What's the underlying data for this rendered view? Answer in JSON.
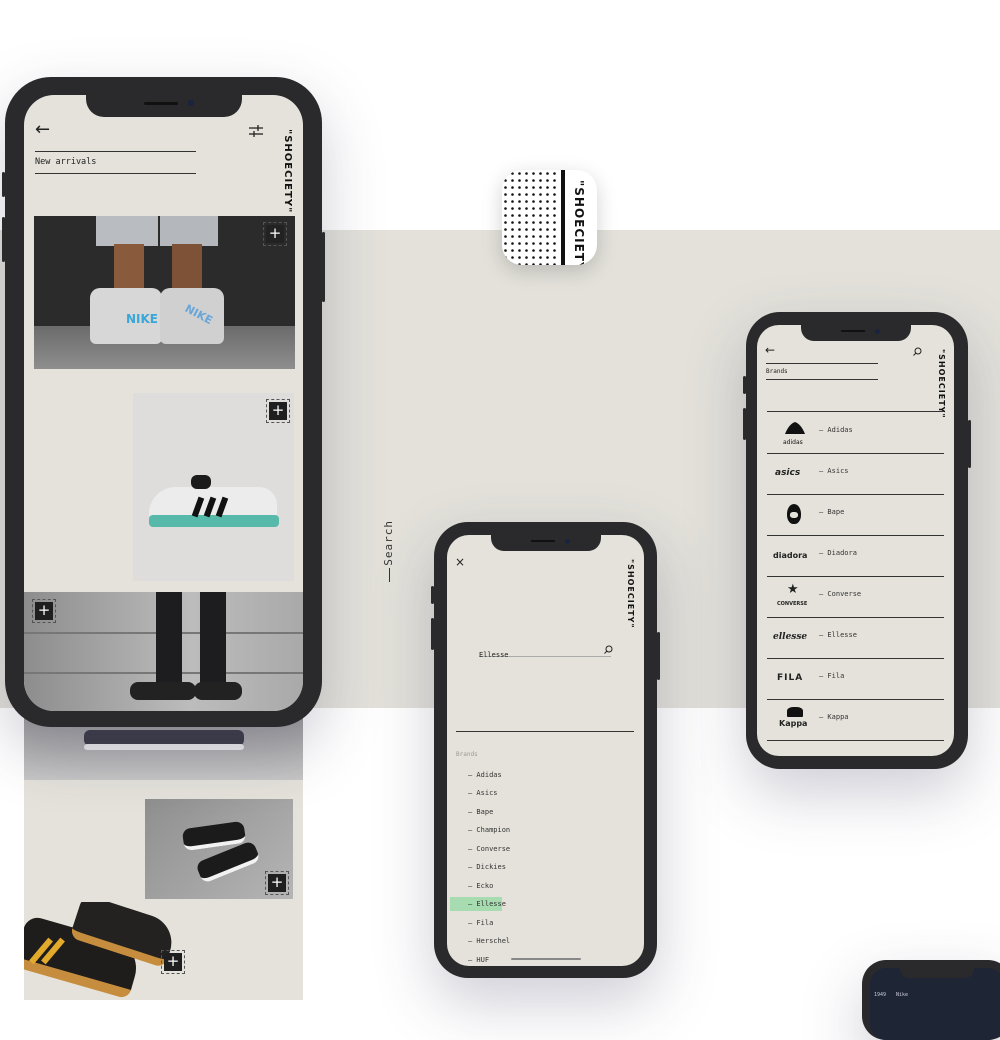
{
  "brand_name": "\"SHOECIETY\"",
  "search_label": "Search",
  "phone1": {
    "title": "New arrivals",
    "shoe_labels": [
      "NIKE",
      "NIKE"
    ]
  },
  "phone_search": {
    "query": "Ellesse",
    "brands_header": "Brands",
    "brands": [
      "— Adidas",
      "— Asics",
      "— Bape",
      "— Champion",
      "— Converse",
      "— Dickies",
      "— Ecko",
      "— Ellesse",
      "— Fila",
      "— Herschel",
      "— HUF"
    ],
    "selected": "— Ellesse"
  },
  "phone_brands": {
    "title": "Brands",
    "items": [
      {
        "name": "— Adidas",
        "logo_text": "adidas",
        "logo_icon": "adidas-trefoil-icon"
      },
      {
        "name": "— Asics",
        "logo_text": "asics",
        "logo_icon": "asics-logo-icon"
      },
      {
        "name": "— Bape",
        "logo_text": "",
        "logo_icon": "bape-ape-head-icon"
      },
      {
        "name": "— Diadora",
        "logo_text": "diadora",
        "logo_icon": "diadora-logo-icon"
      },
      {
        "name": "— Converse",
        "logo_text": "CONVERSE",
        "logo_icon": "converse-star-icon"
      },
      {
        "name": "— Ellesse",
        "logo_text": "ellesse",
        "logo_icon": "ellesse-logo-icon"
      },
      {
        "name": "— Fila",
        "logo_text": "FILA",
        "logo_icon": "fila-logo-icon"
      },
      {
        "name": "— Kappa",
        "logo_text": "Kappa",
        "logo_icon": "kappa-omini-icon"
      }
    ]
  },
  "phone4": {
    "row_number": "1949",
    "row_name": "Nike"
  },
  "colors": {
    "screen_bg": "#e4e2da",
    "band_bg": "#e3e1da",
    "phone_frame": "#2a2a2c",
    "highlight": "#a6dcb0"
  }
}
